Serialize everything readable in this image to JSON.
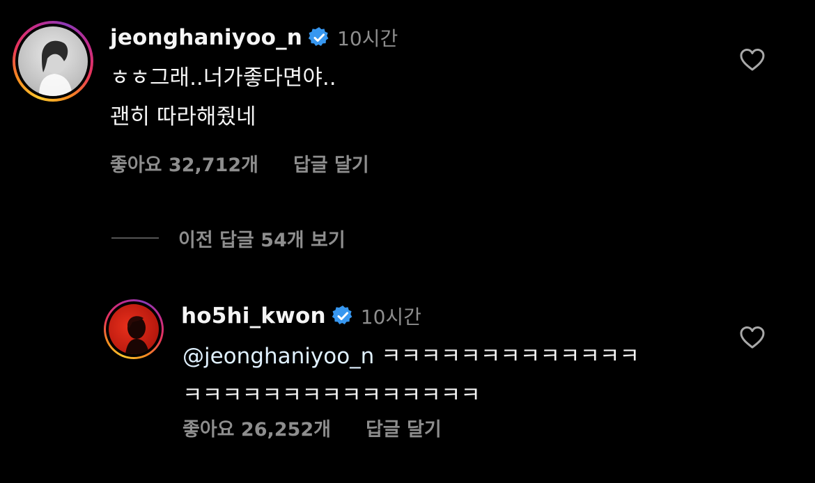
{
  "comments": [
    {
      "username": "jeonghaniyoo_n",
      "time": "10시간",
      "lines": [
        "ㅎㅎ그래..너가좋다면야..",
        "괜히 따라해줬네"
      ],
      "likes": "좋아요 32,712개",
      "reply_label": "답글 달기"
    },
    {
      "username": "ho5hi_kwon",
      "time": "10시간",
      "mention": "@jeonghaniyoo_n",
      "line1_rest": " ㅋㅋㅋㅋㅋㅋㅋㅋㅋㅋㅋㅋㅋ",
      "line2": "ㅋㅋㅋㅋㅋㅋㅋㅋㅋㅋㅋㅋㅋㅋㅋ",
      "likes": "좋아요 26,252개",
      "reply_label": "답글 달기"
    }
  ],
  "view_replies": "이전 답글 54개 보기",
  "colors": {
    "background": "#000000",
    "text": "#f5f5f5",
    "muted": "#8e8e8e",
    "verified": "#3797f0"
  },
  "icons": [
    "verified-badge-icon",
    "heart-icon"
  ]
}
